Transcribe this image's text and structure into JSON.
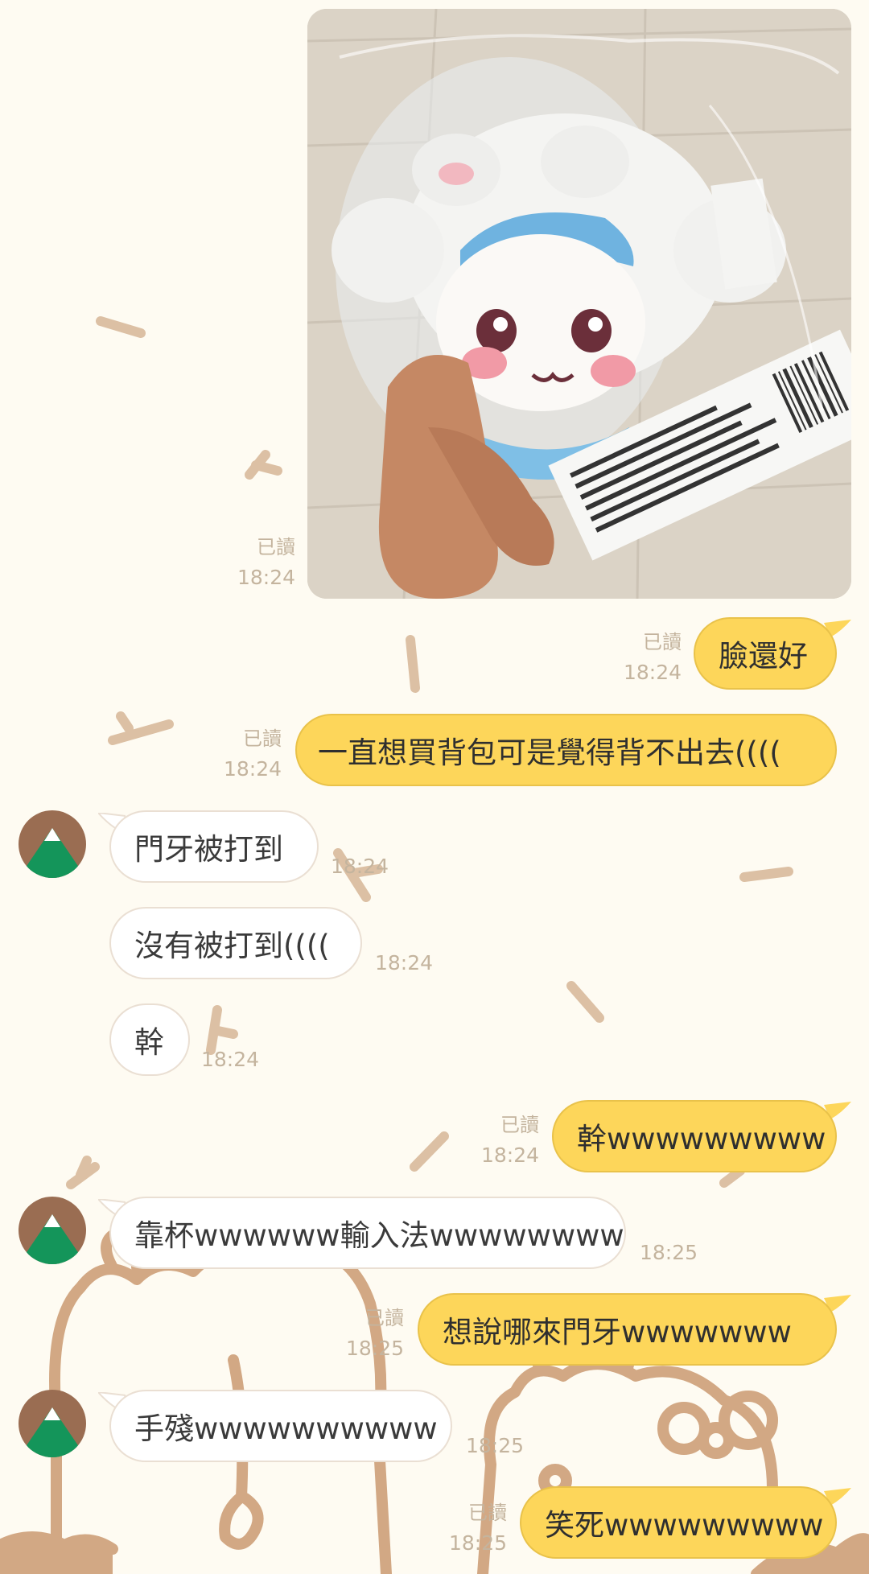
{
  "colors": {
    "background": "#fefbf2",
    "outgoing_bubble": "#fdd65a",
    "incoming_bubble": "#ffffff",
    "meta_text": "#c4b49e",
    "avatar_brown": "#9a6d52",
    "avatar_green": "#14955a"
  },
  "photo_message": {
    "icon": "chiikawa-plush-photo",
    "read": "已讀",
    "time": "18:24"
  },
  "messages": [
    {
      "side": "out",
      "text": "臉還好",
      "read": "已讀",
      "time": "18:24"
    },
    {
      "side": "out",
      "text": "一直想買背包可是覺得背不出去((((",
      "read": "已讀",
      "time": "18:24"
    },
    {
      "side": "in",
      "text": "門牙被打到",
      "time": "18:24"
    },
    {
      "side": "in",
      "text": "沒有被打到((((",
      "time": "18:24"
    },
    {
      "side": "in",
      "text": "幹",
      "time": "18:24"
    },
    {
      "side": "out",
      "text": "幹wwwwwwwww",
      "read": "已讀",
      "time": "18:24"
    },
    {
      "side": "in",
      "text": "靠杯wwwwww輸入法wwwwwwww",
      "time": "18:25"
    },
    {
      "side": "out",
      "text": "想說哪來門牙wwwwwww",
      "read": "已讀",
      "time": "18:25"
    },
    {
      "side": "in",
      "text": "手殘wwwwwwwwww",
      "time": "18:25"
    },
    {
      "side": "out",
      "text": "笑死wwwwwwwww",
      "read": "已讀",
      "time": "18:25"
    }
  ]
}
